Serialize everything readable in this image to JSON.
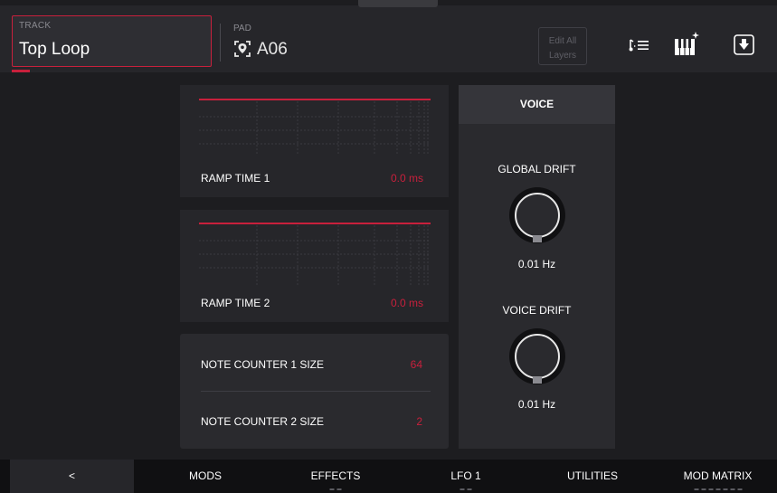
{
  "header": {
    "track_label": "TRACK",
    "track_value": "Top Loop",
    "pad_label": "PAD",
    "pad_value": "A06",
    "edit_all_line1": "Edit All",
    "edit_all_line2": "Layers"
  },
  "ramp1": {
    "label": "RAMP TIME 1",
    "value": "0.0 ms"
  },
  "ramp2": {
    "label": "RAMP TIME 2",
    "value": "0.0 ms"
  },
  "counters": {
    "counter1_label": "NOTE COUNTER 1 SIZE",
    "counter1_value": "64",
    "counter2_label": "NOTE COUNTER 2 SIZE",
    "counter2_value": "2"
  },
  "voice": {
    "title": "VOICE",
    "global_drift_label": "GLOBAL DRIFT",
    "global_drift_value": "0.01 Hz",
    "voice_drift_label": "VOICE DRIFT",
    "voice_drift_value": "0.01 Hz"
  },
  "tabs": {
    "back": "<",
    "mods": "MODS",
    "effects": "EFFECTS",
    "lfo1": "LFO 1",
    "utilities": "UTILITIES",
    "mod_matrix": "MOD MATRIX",
    "active": "UTILITIES"
  },
  "colors": {
    "accent": "#c8203c",
    "panel": "#26262a",
    "background": "#1d1d20"
  },
  "icons": {
    "pad": "pad-location-icon",
    "sequence": "note-list-icon",
    "keyboard": "keyboard-sparkle-icon",
    "save": "download-icon"
  }
}
